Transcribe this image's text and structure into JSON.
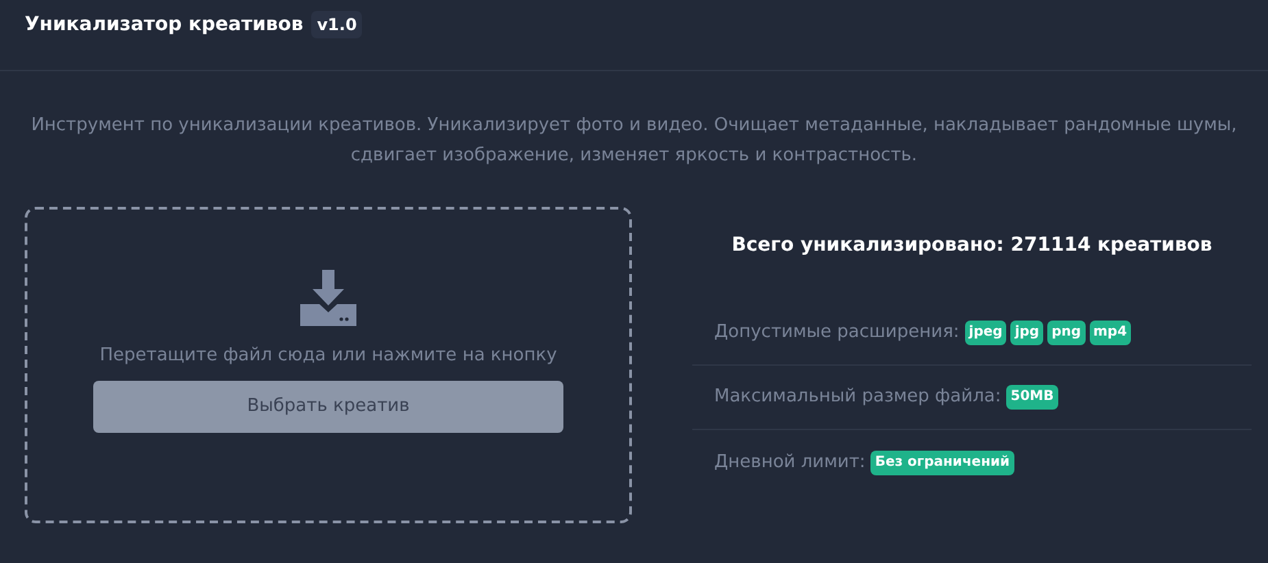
{
  "header": {
    "title": "Уникализатор креативов",
    "version": "v1.0"
  },
  "description": "Инструмент по уникализации креативов. Уникализирует фото и видео. Очищает метаданные, накладывает рандомные шумы, сдвигает изображение, изменяет яркость и контрастность.",
  "dropzone": {
    "hint": "Перетащите файл сюда или нажмите на кнопку",
    "button": "Выбрать креатив"
  },
  "stats": {
    "title": "Всего уникализировано: 271114 креативов",
    "rows": [
      {
        "label": "Допустимые расширения:",
        "badges": [
          "jpeg",
          "jpg",
          "png",
          "mp4"
        ]
      },
      {
        "label": "Максимальный размер файла:",
        "badges": [
          "50MB"
        ]
      },
      {
        "label": "Дневной лимит:",
        "badges": [
          "Без ограничений"
        ]
      }
    ]
  }
}
